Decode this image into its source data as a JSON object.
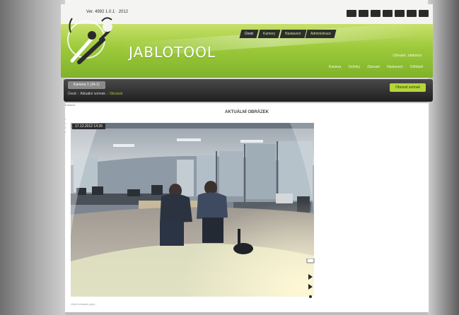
{
  "header": {
    "version": "Ver. 4992 1.0.1 · 2012",
    "logo_text": "JABLOTOOL",
    "nav_tabs": [
      {
        "label": "Úvod",
        "active": true
      },
      {
        "label": "Kamery",
        "active": false
      },
      {
        "label": "Nastavení",
        "active": false
      },
      {
        "label": "Administrace",
        "active": false
      }
    ],
    "sub_info": "Uživatel: Jablotool",
    "sub_links": [
      "Kamera",
      "Snímky",
      "Záznam",
      "Nastavení",
      "Odhlásit"
    ],
    "icons": [
      "phone-icon",
      "user-icon",
      "monitor-icon",
      "plus-icon",
      "link-icon",
      "camera-icon",
      "mail-icon"
    ]
  },
  "band": {
    "left_button": "Kamera 1 (JA-1)",
    "right_button": "Obnovit snímek",
    "breadcrumb": [
      "Úvod",
      "Aktuální snímek",
      "Obrázek"
    ]
  },
  "content": {
    "top_label": "Kamera",
    "title": "AKTUÁLNÍ OBRÁZEK",
    "image_caption": "17.12.2012 14:26",
    "bottom_label": "Uložit obrázek jako..."
  },
  "colors": {
    "banner_green": "#9cc93a",
    "accent_green": "#b5d63a",
    "dark_band": "#2b2b2b",
    "content_bg": "#ffffff"
  }
}
